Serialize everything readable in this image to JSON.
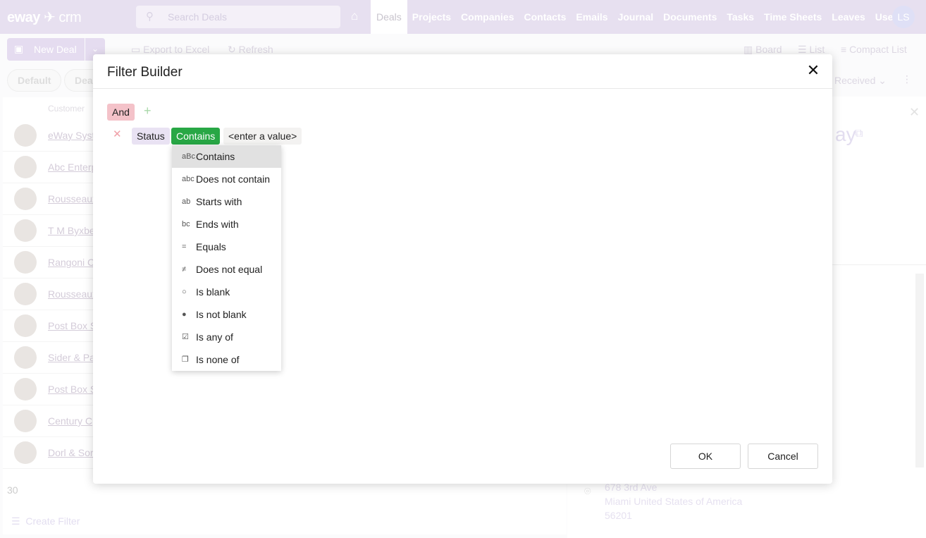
{
  "header": {
    "logo": "eway",
    "logo_suffix": "crm",
    "search_placeholder": "Search Deals",
    "nav": [
      "Deals",
      "Projects",
      "Companies",
      "Contacts",
      "Emails",
      "Journal",
      "Documents",
      "Tasks",
      "Time Sheets",
      "Leaves",
      "Users"
    ],
    "active_nav": "Deals",
    "avatar": "LS"
  },
  "toolbar": {
    "new_deal": "New Deal",
    "export": "Export to Excel",
    "refresh": "Refresh",
    "views": [
      "Board",
      "List",
      "Compact List"
    ]
  },
  "filters": {
    "chips": [
      "Default",
      "Deal"
    ],
    "sort": "Received"
  },
  "list": {
    "column": "Customer",
    "rows": [
      "eWay Syst",
      "Abc Enterp",
      "Rousseaux",
      "T M Byxbe",
      "Rangoni C",
      "Rousseaux",
      "Post Box S",
      "Sider & Pa",
      "Post Box S",
      "Century C",
      "Dorl & Sor"
    ],
    "count": "30",
    "create_filter": "Create Filter"
  },
  "detail": {
    "title_fragment": "ay",
    "address": [
      "678 3rd Ave",
      "Miami United States of America",
      "56201"
    ]
  },
  "modal": {
    "title": "Filter Builder",
    "group_operator": "And",
    "condition": {
      "field": "Status",
      "operator": "Contains",
      "value_placeholder": "<enter a value>"
    },
    "operators": [
      {
        "icon": "abc-contains-icon",
        "glyph": "aBc",
        "label": "Contains"
      },
      {
        "icon": "abc-not-contains-icon",
        "glyph": "abc",
        "label": "Does not contain"
      },
      {
        "icon": "abc-starts-icon",
        "glyph": "ab",
        "label": "Starts with"
      },
      {
        "icon": "abc-ends-icon",
        "glyph": "bc",
        "label": "Ends with"
      },
      {
        "icon": "equals-icon",
        "glyph": "=",
        "label": "Equals"
      },
      {
        "icon": "not-equal-icon",
        "glyph": "≠",
        "label": "Does not equal"
      },
      {
        "icon": "circle-outline-icon",
        "glyph": "○",
        "label": "Is blank"
      },
      {
        "icon": "circle-filled-icon",
        "glyph": "●",
        "label": "Is not blank"
      },
      {
        "icon": "checkbox-checked-icon",
        "glyph": "☑",
        "label": "Is any of"
      },
      {
        "icon": "copy-box-icon",
        "glyph": "❐",
        "label": "Is none of"
      }
    ],
    "ok": "OK",
    "cancel": "Cancel"
  },
  "colors": {
    "and_chip": "#f4c2c9",
    "field_chip": "#e9e2f3",
    "operator_chip": "#28a745",
    "value_chip": "#f3f2f1",
    "header_bg": "#e7e0f0"
  }
}
